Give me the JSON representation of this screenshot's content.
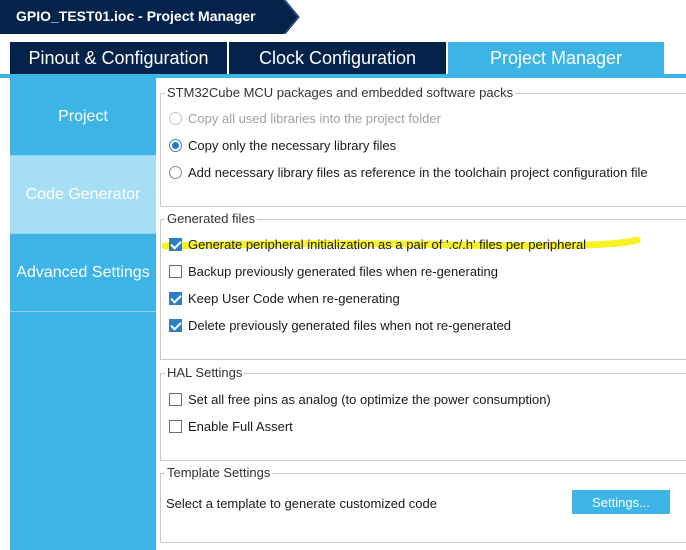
{
  "breadcrumb": {
    "title": "GPIO_TEST01.ioc - Project Manager"
  },
  "tabs": [
    {
      "label": "Pinout & Configuration",
      "active": false
    },
    {
      "label": "Clock Configuration",
      "active": false
    },
    {
      "label": "Project Manager",
      "active": true
    }
  ],
  "sidebar": {
    "items": [
      {
        "label": "Project",
        "selected": false
      },
      {
        "label": "Code Generator",
        "selected": true
      },
      {
        "label": "Advanced Settings",
        "selected": false
      }
    ]
  },
  "packages": {
    "title": "STM32Cube MCU packages and embedded software packs",
    "options": [
      {
        "label": "Copy all used libraries into the project folder",
        "checked": false,
        "disabled": true
      },
      {
        "label": "Copy only the necessary library files",
        "checked": true,
        "disabled": false
      },
      {
        "label": "Add necessary library files as reference in the toolchain project configuration file",
        "checked": false,
        "disabled": false
      }
    ]
  },
  "generated": {
    "title": "Generated files",
    "options": [
      {
        "label": "Generate peripheral initialization as a pair of '.c/.h' files per peripheral",
        "checked": true
      },
      {
        "label": "Backup previously generated files when re-generating",
        "checked": false
      },
      {
        "label": "Keep User Code when re-generating",
        "checked": true
      },
      {
        "label": "Delete previously generated files when not re-generated",
        "checked": true
      }
    ]
  },
  "hal": {
    "title": "HAL Settings",
    "options": [
      {
        "label": "Set all free pins as analog (to optimize the power consumption)",
        "checked": false
      },
      {
        "label": "Enable Full Assert",
        "checked": false
      }
    ]
  },
  "template": {
    "title": "Template Settings",
    "text": "Select a template to generate customized code",
    "button_label": "Settings..."
  },
  "colors": {
    "navy": "#03234b",
    "accent": "#3cb4e6",
    "highlight": "#f5f000"
  }
}
